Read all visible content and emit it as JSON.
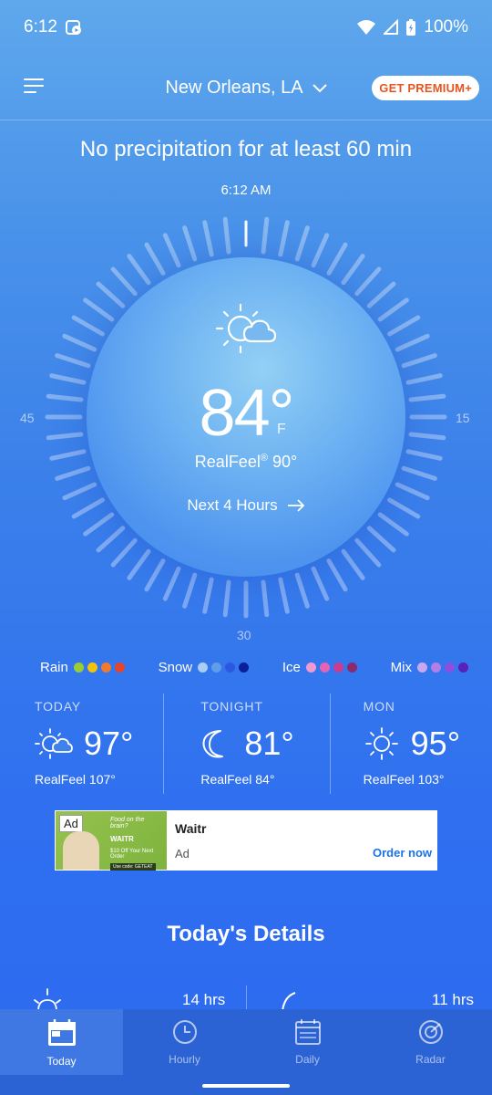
{
  "status": {
    "time": "6:12",
    "battery": "100%"
  },
  "header": {
    "location": "New Orleans, LA",
    "premium_label": "GET PREMIUM+"
  },
  "minutecast": {
    "message": "No precipitation for at least 60 min",
    "time": "6:12 AM"
  },
  "dial_labels": {
    "left": "45",
    "right": "15",
    "bottom": "30"
  },
  "current": {
    "temp": "84°",
    "unit": "F",
    "realfeel_label": "RealFeel",
    "realfeel_mark": "®",
    "realfeel_value": "90°",
    "next_hours": "Next 4 Hours",
    "icon": "partly-sunny-icon"
  },
  "legend": [
    {
      "label": "Rain",
      "colors": [
        "#9acd32",
        "#f4c20d",
        "#f07b2e",
        "#e5452b"
      ]
    },
    {
      "label": "Snow",
      "colors": [
        "#a9cdf5",
        "#5f9de9",
        "#2c58e0",
        "#0b1f9a"
      ]
    },
    {
      "label": "Ice",
      "colors": [
        "#f29ad0",
        "#e463b4",
        "#c93c92",
        "#8a2a6a"
      ]
    },
    {
      "label": "Mix",
      "colors": [
        "#c9a8f0",
        "#b07fea",
        "#8d4fe0",
        "#5b20b8"
      ]
    }
  ],
  "forecast": [
    {
      "label": "TODAY",
      "temp": "97°",
      "realfeel": "RealFeel 107°",
      "icon": "partly-sunny-icon"
    },
    {
      "label": "TONIGHT",
      "temp": "81°",
      "realfeel": "RealFeel 84°",
      "icon": "moon-icon"
    },
    {
      "label": "MON",
      "temp": "95°",
      "realfeel": "RealFeel 103°",
      "icon": "sun-icon"
    }
  ],
  "ad": {
    "badge": "Ad",
    "title": "Waitr",
    "sub": "Ad",
    "cta": "Order now",
    "img_line1": "Food on the brain?",
    "img_brand": "WAITR",
    "img_offer": "$10 Off Your Next Order",
    "img_code": "Use code: GETEAT"
  },
  "details": {
    "title": "Today's Details",
    "left_value": "14 hrs",
    "right_value": "11 hrs"
  },
  "nav": [
    {
      "label": "Today",
      "icon": "calendar-today-icon"
    },
    {
      "label": "Hourly",
      "icon": "clock-icon"
    },
    {
      "label": "Daily",
      "icon": "calendar-icon"
    },
    {
      "label": "Radar",
      "icon": "radar-icon"
    }
  ],
  "colors": {
    "premium_text": "#e8541e",
    "nav_bg": "#2b62d4",
    "ad_cta": "#1a73e8"
  }
}
